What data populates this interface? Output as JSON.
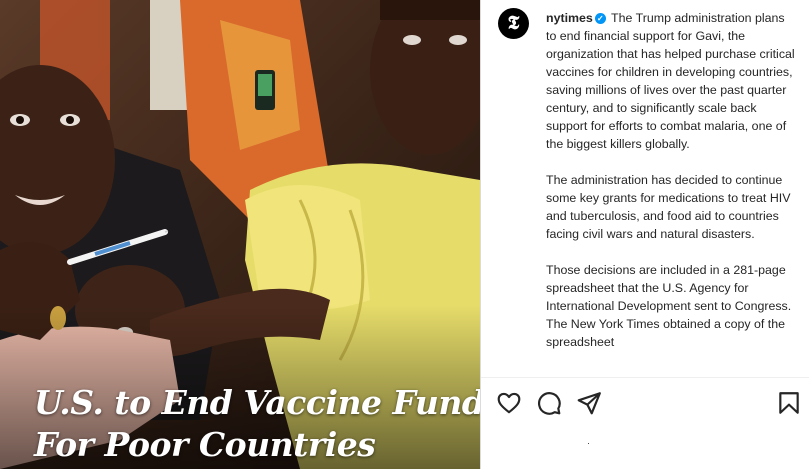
{
  "photo": {
    "headline_line1": "U.S. to End Vaccine Funds",
    "headline_line2": "For Poor Countries"
  },
  "post": {
    "avatar_glyph": "𝕿",
    "username": "nytimes",
    "verified_icon": "verified-badge-icon",
    "caption_p1": "The Trump administration plans to end financial support for Gavi, the organization that has helped purchase critical vaccines for children in developing countries, saving millions of lives over the past quarter century, and to significantly scale back support for efforts to combat malaria, one of the biggest killers globally.",
    "caption_p2": "The administration has decided to continue some key grants for medications to treat HIV and tuberculosis, and food aid to countries facing civil wars and natural disasters.",
    "caption_p3": "Those decisions are included in a 281-page spreadsheet that the U.S. Agency for International Development sent to Congress. The New York Times obtained a copy of the spreadsheet",
    "actions": [
      "heart-icon",
      "comment-icon",
      "share-icon",
      "bookmark-icon"
    ],
    "footer_mark": "·"
  },
  "colors": {
    "verified": "#0095f6",
    "text": "#262626",
    "border": "#dbdbdb"
  }
}
